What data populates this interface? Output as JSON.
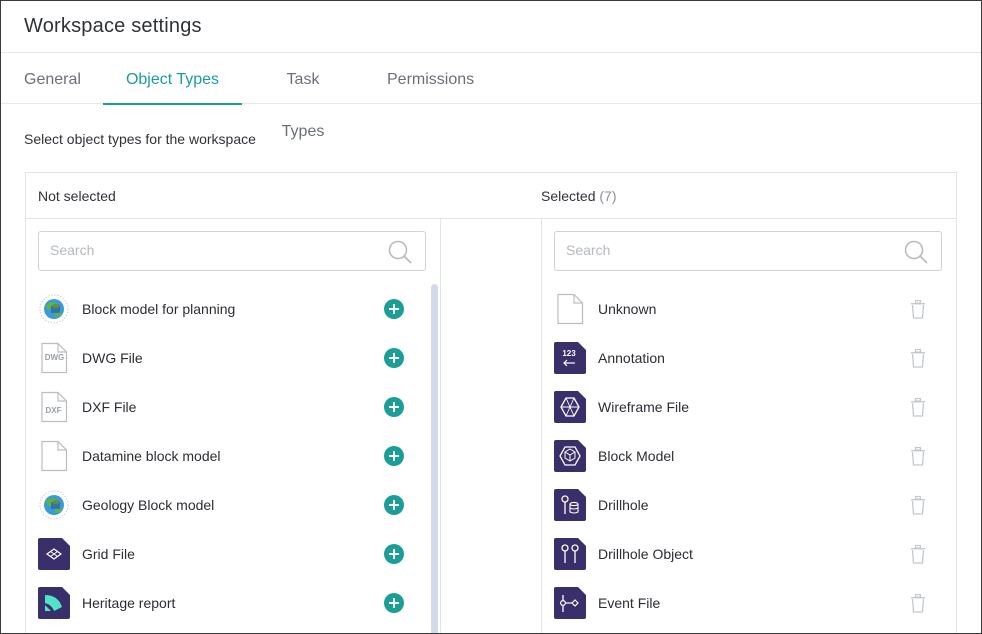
{
  "header": {
    "title": "Workspace settings"
  },
  "tabs": [
    {
      "label": "General",
      "active": false
    },
    {
      "label": "Object Types",
      "active": true
    },
    {
      "label": "Task Types",
      "active": false
    },
    {
      "label": "Permissions",
      "active": false
    }
  ],
  "instruction": "Select object types for the workspace",
  "not_selected": {
    "heading": "Not selected",
    "search_placeholder": "Search",
    "items": [
      {
        "label": "Block model for planning",
        "icon": "globe-planning-icon"
      },
      {
        "label": "DWG File",
        "icon": "dwg-file-icon"
      },
      {
        "label": "DXF File",
        "icon": "dxf-file-icon"
      },
      {
        "label": "Datamine block model",
        "icon": "blank-file-icon"
      },
      {
        "label": "Geology Block model",
        "icon": "globe-geology-icon"
      },
      {
        "label": "Grid File",
        "icon": "grid-icon"
      },
      {
        "label": "Heritage report",
        "icon": "heritage-icon"
      }
    ]
  },
  "selected": {
    "heading": "Selected",
    "count": "(7)",
    "search_placeholder": "Search",
    "items": [
      {
        "label": "Unknown",
        "icon": "blank-file-icon"
      },
      {
        "label": "Annotation",
        "icon": "annotation-icon"
      },
      {
        "label": "Wireframe File",
        "icon": "wireframe-icon"
      },
      {
        "label": "Block Model",
        "icon": "block-model-icon"
      },
      {
        "label": "Drillhole",
        "icon": "drillhole-icon"
      },
      {
        "label": "Drillhole Object",
        "icon": "drillhole-object-icon"
      },
      {
        "label": "Event File",
        "icon": "event-file-icon"
      }
    ]
  },
  "colors": {
    "accent": "#1a9e96",
    "icon_tile": "#3a2f6b",
    "border": "#e1e4e8"
  }
}
